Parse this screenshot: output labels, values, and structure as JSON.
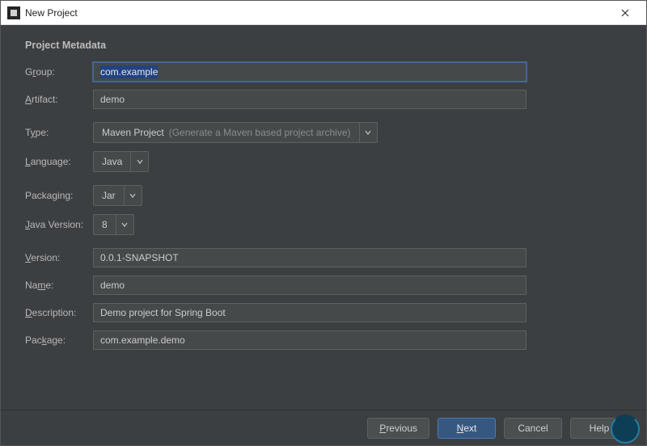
{
  "window": {
    "title": "New Project"
  },
  "section_title": "Project Metadata",
  "fields": {
    "group": {
      "label_pre": "G",
      "label_ul": "r",
      "label_post": "oup:",
      "value": "com.example"
    },
    "artifact": {
      "label_pre": "",
      "label_ul": "A",
      "label_post": "rtifact:",
      "value": "demo"
    },
    "type": {
      "label_pre": "T",
      "label_ul": "y",
      "label_post": "pe:",
      "value": "Maven Project",
      "hint": "(Generate a Maven based project archive)"
    },
    "language": {
      "label_pre": "",
      "label_ul": "L",
      "label_post": "anguage:",
      "value": "Java"
    },
    "packaging": {
      "label_pre": "Packa",
      "label_ul": "g",
      "label_post": "ing:",
      "value": "Jar"
    },
    "java_version": {
      "label_pre": "",
      "label_ul": "J",
      "label_post": "ava Version:",
      "value": "8"
    },
    "version": {
      "label_pre": "",
      "label_ul": "V",
      "label_post": "ersion:",
      "value": "0.0.1-SNAPSHOT"
    },
    "name": {
      "label_pre": "Na",
      "label_ul": "m",
      "label_post": "e:",
      "value": "demo"
    },
    "description": {
      "label_pre": "",
      "label_ul": "D",
      "label_post": "escription:",
      "value": "Demo project for Spring Boot"
    },
    "package": {
      "label_pre": "Pac",
      "label_ul": "k",
      "label_post": "age:",
      "value": "com.example.demo"
    }
  },
  "buttons": {
    "previous": {
      "pre": "",
      "ul": "P",
      "post": "revious"
    },
    "next": {
      "pre": "",
      "ul": "N",
      "post": "ext"
    },
    "cancel": {
      "text": "Cancel"
    },
    "help": {
      "text": "Help"
    }
  }
}
